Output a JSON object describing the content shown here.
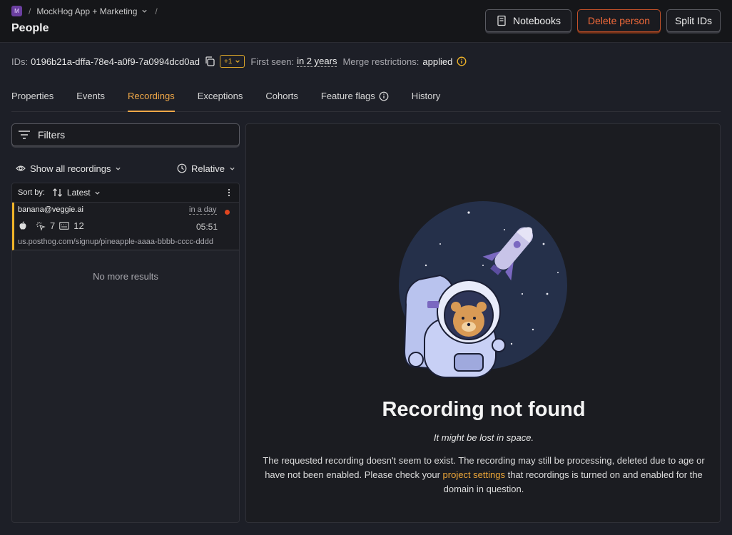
{
  "breadcrumb": {
    "project_badge": "M",
    "separator": "/",
    "project": "MockHog App + Marketing"
  },
  "header": {
    "title": "People",
    "notebooks_label": "Notebooks",
    "delete_label": "Delete person",
    "split_label": "Split IDs"
  },
  "person": {
    "ids_label": "IDs:",
    "ids_value": "0196b21a-dffa-78e4-a0f9-7a0994dcd0ad",
    "extra_ids": "+1",
    "first_seen_label": "First seen:",
    "first_seen_value": "in 2 years",
    "merge_label": "Merge restrictions:",
    "merge_value": "applied"
  },
  "tabs": [
    "Properties",
    "Events",
    "Recordings",
    "Exceptions",
    "Cohorts",
    "Feature flags",
    "History"
  ],
  "active_tab": "Recordings",
  "filters": {
    "label": "Filters",
    "show_all": "Show all recordings",
    "relative": "Relative"
  },
  "list": {
    "sort_label": "Sort by:",
    "sort_value": "Latest",
    "items": [
      {
        "email": "banana@veggie.ai",
        "time": "in a day",
        "clicks": "7",
        "keys": "12",
        "duration": "05:51",
        "url": "us.posthog.com/signup/pineapple-aaaa-bbbb-cccc-dddd"
      }
    ],
    "no_more": "No more results"
  },
  "not_found": {
    "title": "Recording not found",
    "subtitle": "It might be lost in space.",
    "desc_before": "The requested recording doesn't seem to exist. The recording may still be processing, deleted due to age or have not been enabled. Please check your ",
    "link_text": "project settings",
    "desc_after": " that recordings is turned on and enabled for the domain in question."
  },
  "colors": {
    "accent": "#f0a848",
    "danger": "#f26a3a",
    "live": "#e0451f",
    "badge": "#f0b429"
  }
}
